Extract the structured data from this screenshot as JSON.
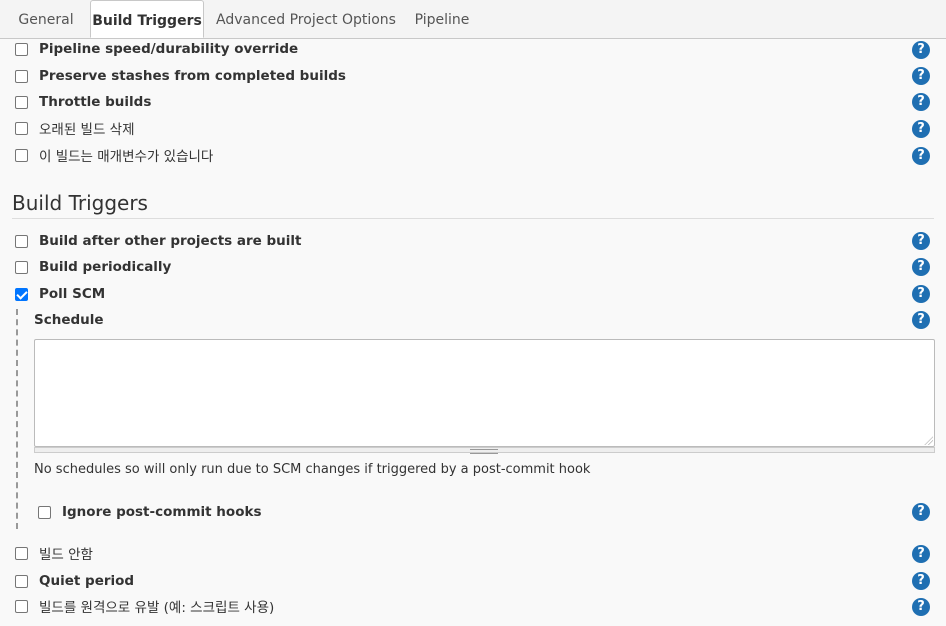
{
  "tabs": [
    "General",
    "Build Triggers",
    "Advanced Project Options",
    "Pipeline"
  ],
  "options_top": [
    {
      "label": "Pipeline speed/durability override",
      "checked": false
    },
    {
      "label": "Preserve stashes from completed builds",
      "checked": false
    },
    {
      "label": "Throttle builds",
      "checked": false
    },
    {
      "label": "오래된 빌드 삭제",
      "checked": false
    },
    {
      "label": "이 빌드는 매개변수가 있습니다",
      "checked": false
    }
  ],
  "section_title": "Build Triggers",
  "triggers": [
    {
      "label": "Build after other projects are built",
      "checked": false
    },
    {
      "label": "Build periodically",
      "checked": false
    },
    {
      "label": "Poll SCM",
      "checked": true
    }
  ],
  "poll_scm": {
    "schedule_label": "Schedule",
    "schedule_value": "",
    "hint": "No schedules so will only run due to SCM changes if triggered by a post-commit hook",
    "ignore_hooks_label": "Ignore post-commit hooks",
    "ignore_hooks_checked": false
  },
  "triggers_bottom": [
    {
      "label": "빌드 안함",
      "checked": false
    },
    {
      "label": "Quiet period",
      "checked": false
    },
    {
      "label": "빌드를 원격으로 유발 (예: 스크립트 사용)",
      "checked": false
    }
  ],
  "help_glyph": "?",
  "colors": {
    "help": "#1f6fb2",
    "checkbox_checked": "#0075ff"
  }
}
